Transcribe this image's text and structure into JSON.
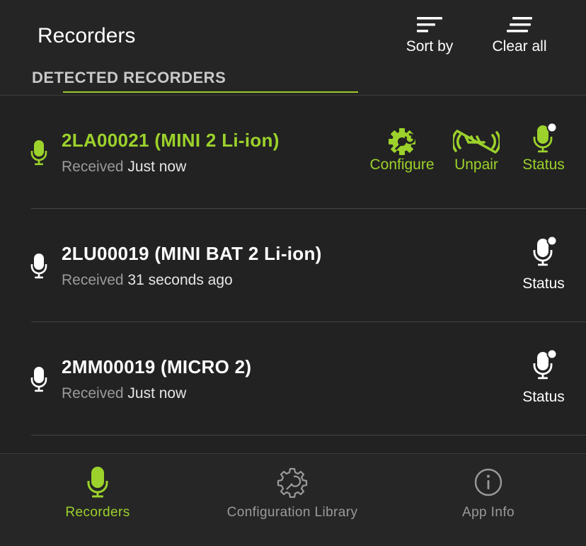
{
  "header": {
    "title": "Recorders",
    "sort_label": "Sort by",
    "clear_label": "Clear all",
    "section_label": "DETECTED RECORDERS"
  },
  "recorders": [
    {
      "name": "2LA00021 (MINI 2 Li-ion)",
      "received_label": "Received",
      "received_value": "Just now",
      "selected": true,
      "actions": [
        "Configure",
        "Unpair",
        "Status"
      ]
    },
    {
      "name": "2LU00019 (MINI BAT 2 Li-ion)",
      "received_label": "Received",
      "received_value": "31 seconds ago",
      "selected": false,
      "actions": [
        "Status"
      ]
    },
    {
      "name": "2MM00019 (MICRO 2)",
      "received_label": "Received",
      "received_value": "Just now",
      "selected": false,
      "actions": [
        "Status"
      ]
    }
  ],
  "tabs": [
    {
      "label": "Recorders",
      "icon": "mic-icon",
      "active": true
    },
    {
      "label": "Configuration Library",
      "icon": "gear-icon",
      "active": false
    },
    {
      "label": "App Info",
      "icon": "info-icon",
      "active": false
    }
  ],
  "colors": {
    "accent": "#9cd22b",
    "background": "#222222",
    "muted": "#9a9a9a"
  }
}
